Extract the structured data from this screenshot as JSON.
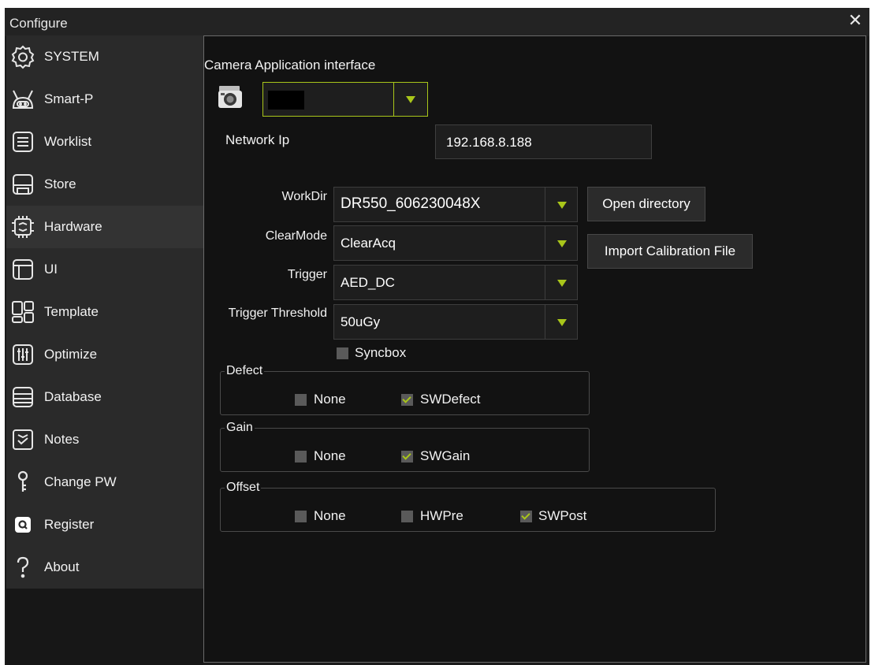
{
  "window": {
    "title": "Configure",
    "close_icon": "close-icon"
  },
  "sidebar": {
    "items": [
      {
        "label": "SYSTEM",
        "icon": "gear-icon"
      },
      {
        "label": "Smart-P",
        "icon": "robot-icon"
      },
      {
        "label": "Worklist",
        "icon": "list-icon"
      },
      {
        "label": "Store",
        "icon": "save-icon"
      },
      {
        "label": "Hardware",
        "icon": "hardware-icon",
        "active": true
      },
      {
        "label": "UI",
        "icon": "window-layout-icon"
      },
      {
        "label": "Template",
        "icon": "template-icon"
      },
      {
        "label": "Optimize",
        "icon": "sliders-icon"
      },
      {
        "label": "Database",
        "icon": "database-icon"
      },
      {
        "label": "Notes",
        "icon": "notes-check-icon"
      },
      {
        "label": "Change PW",
        "icon": "key-icon"
      },
      {
        "label": "Register",
        "icon": "register-icon"
      },
      {
        "label": "About",
        "icon": "question-icon"
      }
    ]
  },
  "hardware": {
    "camera_interface_label": "Camera Application interface",
    "camera_icon": "camera-icon",
    "camera_select_value": "",
    "network_ip_label": "Network Ip",
    "network_ip_value": "192.168.8.188",
    "workdir_label": "WorkDir",
    "workdir_value": "DR550_606230048X",
    "open_directory_label": "Open directory",
    "clearmode_label": "ClearMode",
    "clearmode_value": "ClearAcq",
    "import_calibration_label": "Import Calibration File",
    "trigger_label": "Trigger",
    "trigger_value": "AED_DC",
    "trigger_threshold_label": "Trigger Threshold",
    "trigger_threshold_value": "50uGy",
    "syncbox_label": "Syncbox",
    "syncbox_checked": false
  },
  "defect": {
    "title": "Defect",
    "options": [
      {
        "label": "None",
        "checked": false
      },
      {
        "label": "SWDefect",
        "checked": true
      }
    ]
  },
  "gain": {
    "title": "Gain",
    "options": [
      {
        "label": "None",
        "checked": false
      },
      {
        "label": "SWGain",
        "checked": true
      }
    ]
  },
  "offset": {
    "title": "Offset",
    "options": [
      {
        "label": "None",
        "checked": false
      },
      {
        "label": "HWPre",
        "checked": false
      },
      {
        "label": "SWPost",
        "checked": true
      }
    ]
  },
  "colors": {
    "accent": "#a9c61a",
    "background": "#121212",
    "sidebar": "#2a2a2a"
  }
}
